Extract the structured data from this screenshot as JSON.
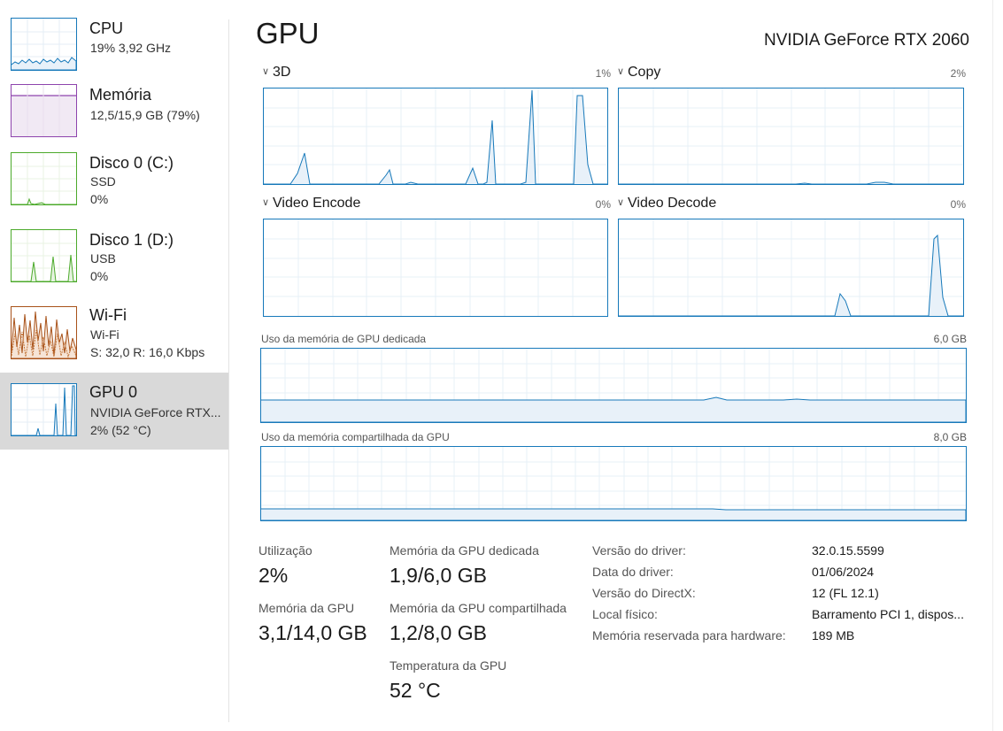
{
  "colors": {
    "gpu_blue": "#1779ba",
    "cpu_blue": "#1779ba",
    "memory_purple": "#8e44ad",
    "disk_green": "#4caa2b",
    "wifi_orange": "#a8521a",
    "selected_bg": "#d9d9d9"
  },
  "sidebar": {
    "items": [
      {
        "name": "CPU",
        "line1": "19%  3,92 GHz",
        "line2": ""
      },
      {
        "name": "Memória",
        "line1": "12,5/15,9 GB (79%)",
        "line2": ""
      },
      {
        "name": "Disco 0 (C:)",
        "line1": "SSD",
        "line2": "0%"
      },
      {
        "name": "Disco 1 (D:)",
        "line1": "USB",
        "line2": "0%"
      },
      {
        "name": "Wi-Fi",
        "line1": "Wi-Fi",
        "line2": "S: 32,0  R: 16,0 Kbps"
      },
      {
        "name": "GPU 0",
        "line1": "NVIDIA GeForce RTX...",
        "line2": "2%  (52 °C)"
      }
    ]
  },
  "header": {
    "title": "GPU",
    "model": "NVIDIA GeForce RTX 2060"
  },
  "engines": {
    "e3d": {
      "label": "3D",
      "percent": "1%"
    },
    "copy": {
      "label": "Copy",
      "percent": "2%"
    },
    "encode": {
      "label": "Video Encode",
      "percent": "0%"
    },
    "decode": {
      "label": "Video Decode",
      "percent": "0%"
    }
  },
  "memory_graphs": {
    "dedicated": {
      "label": "Uso da memória de GPU dedicada",
      "max": "6,0 GB"
    },
    "shared": {
      "label": "Uso da memória compartilhada da GPU",
      "max": "8,0 GB"
    }
  },
  "stats": {
    "utilization": {
      "label": "Utilização",
      "value": "2%"
    },
    "gpu_memory": {
      "label": "Memória da GPU",
      "value": "3,1/14,0 GB"
    },
    "dedicated": {
      "label": "Memória da GPU dedicada",
      "value": "1,9/6,0 GB"
    },
    "shared": {
      "label": "Memória da GPU compartilhada",
      "value": "1,2/8,0 GB"
    },
    "temperature": {
      "label": "Temperatura da GPU",
      "value": "52 °C"
    }
  },
  "info": [
    {
      "label": "Versão do driver:",
      "value": "32.0.15.5599"
    },
    {
      "label": "Data do driver:",
      "value": "01/06/2024"
    },
    {
      "label": "Versão do DirectX:",
      "value": "12 (FL 12.1)"
    },
    {
      "label": "Local físico:",
      "value": "Barramento PCI 1, dispos..."
    },
    {
      "label": "Memória reservada para hardware:",
      "value": "189 MB"
    }
  ]
}
